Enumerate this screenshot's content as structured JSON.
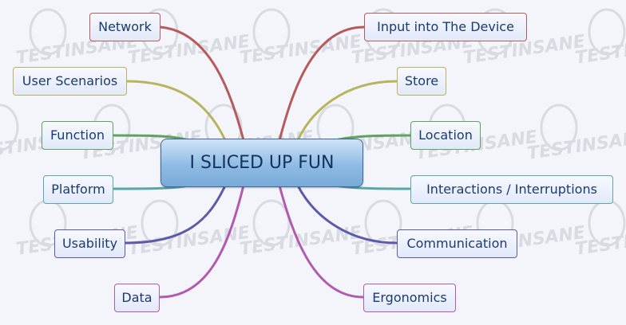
{
  "center": {
    "label": "I SLICED UP FUN"
  },
  "branches": [
    {
      "id": "network",
      "label": "Network",
      "color": "#b55b5b"
    },
    {
      "id": "user-scenarios",
      "label": "User Scenarios",
      "color": "#b7b45e"
    },
    {
      "id": "function",
      "label": "Function",
      "color": "#5fa35f"
    },
    {
      "id": "platform",
      "label": "Platform",
      "color": "#5aa7a7"
    },
    {
      "id": "usability",
      "label": "Usability",
      "color": "#5b5ba8"
    },
    {
      "id": "data",
      "label": "Data",
      "color": "#b05bb0"
    },
    {
      "id": "input-into-the-device",
      "label": "Input into The Device",
      "color": "#b55b5b"
    },
    {
      "id": "store",
      "label": "Store",
      "color": "#b7b45e"
    },
    {
      "id": "location",
      "label": "Location",
      "color": "#5fa35f"
    },
    {
      "id": "interactions-interruptions",
      "label": "Interactions / Interruptions",
      "color": "#5aa7a7"
    },
    {
      "id": "communication",
      "label": "Communication",
      "color": "#5b5ba8"
    },
    {
      "id": "ergonomics",
      "label": "Ergonomics",
      "color": "#b05bb0"
    }
  ],
  "watermark": {
    "text": "TESTINSANE",
    "color": "#d9dbe2"
  }
}
